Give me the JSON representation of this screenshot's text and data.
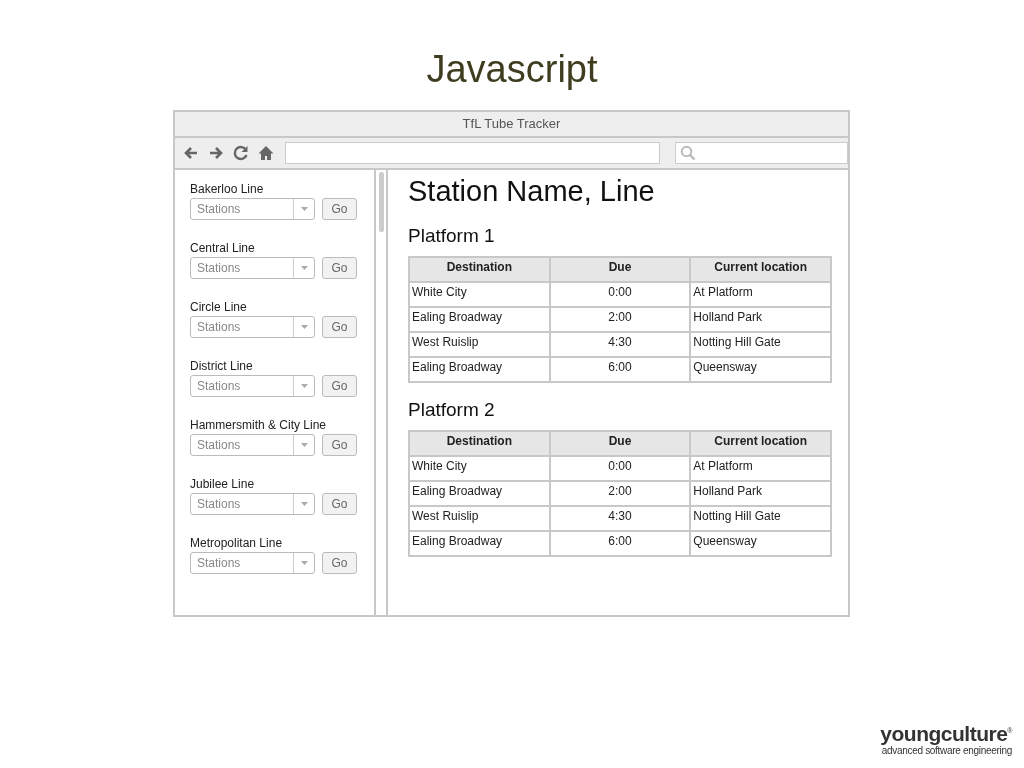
{
  "slide": {
    "title": "Javascript"
  },
  "browser": {
    "title": "TfL Tube Tracker"
  },
  "sidebar": {
    "lines": [
      {
        "label": "Bakerloo Line",
        "dropdown": "Stations",
        "button": "Go"
      },
      {
        "label": "Central Line",
        "dropdown": "Stations",
        "button": "Go"
      },
      {
        "label": "Circle Line",
        "dropdown": "Stations",
        "button": "Go"
      },
      {
        "label": "District Line",
        "dropdown": "Stations",
        "button": "Go"
      },
      {
        "label": "Hammersmith & City Line",
        "dropdown": "Stations",
        "button": "Go"
      },
      {
        "label": "Jubilee Line",
        "dropdown": "Stations",
        "button": "Go"
      },
      {
        "label": "Metropolitan Line",
        "dropdown": "Stations",
        "button": "Go"
      }
    ]
  },
  "main": {
    "heading": "Station Name, Line",
    "platforms": [
      {
        "title": "Platform 1",
        "columns": [
          "Destination",
          "Due",
          "Current location"
        ],
        "rows": [
          [
            "White City",
            "0:00",
            "At Platform"
          ],
          [
            "Ealing Broadway",
            "2:00",
            "Holland Park"
          ],
          [
            "West Ruislip",
            "4:30",
            "Notting Hill Gate"
          ],
          [
            "Ealing Broadway",
            "6:00",
            "Queensway"
          ]
        ]
      },
      {
        "title": "Platform 2",
        "columns": [
          "Destination",
          "Due",
          "Current location"
        ],
        "rows": [
          [
            "White City",
            "0:00",
            "At Platform"
          ],
          [
            "Ealing Broadway",
            "2:00",
            "Holland Park"
          ],
          [
            "West Ruislip",
            "4:30",
            "Notting Hill Gate"
          ],
          [
            "Ealing Broadway",
            "6:00",
            "Queensway"
          ]
        ]
      }
    ]
  },
  "logo": {
    "name": "youngculture$^{®}$",
    "tagline": "advanced software engineering"
  }
}
